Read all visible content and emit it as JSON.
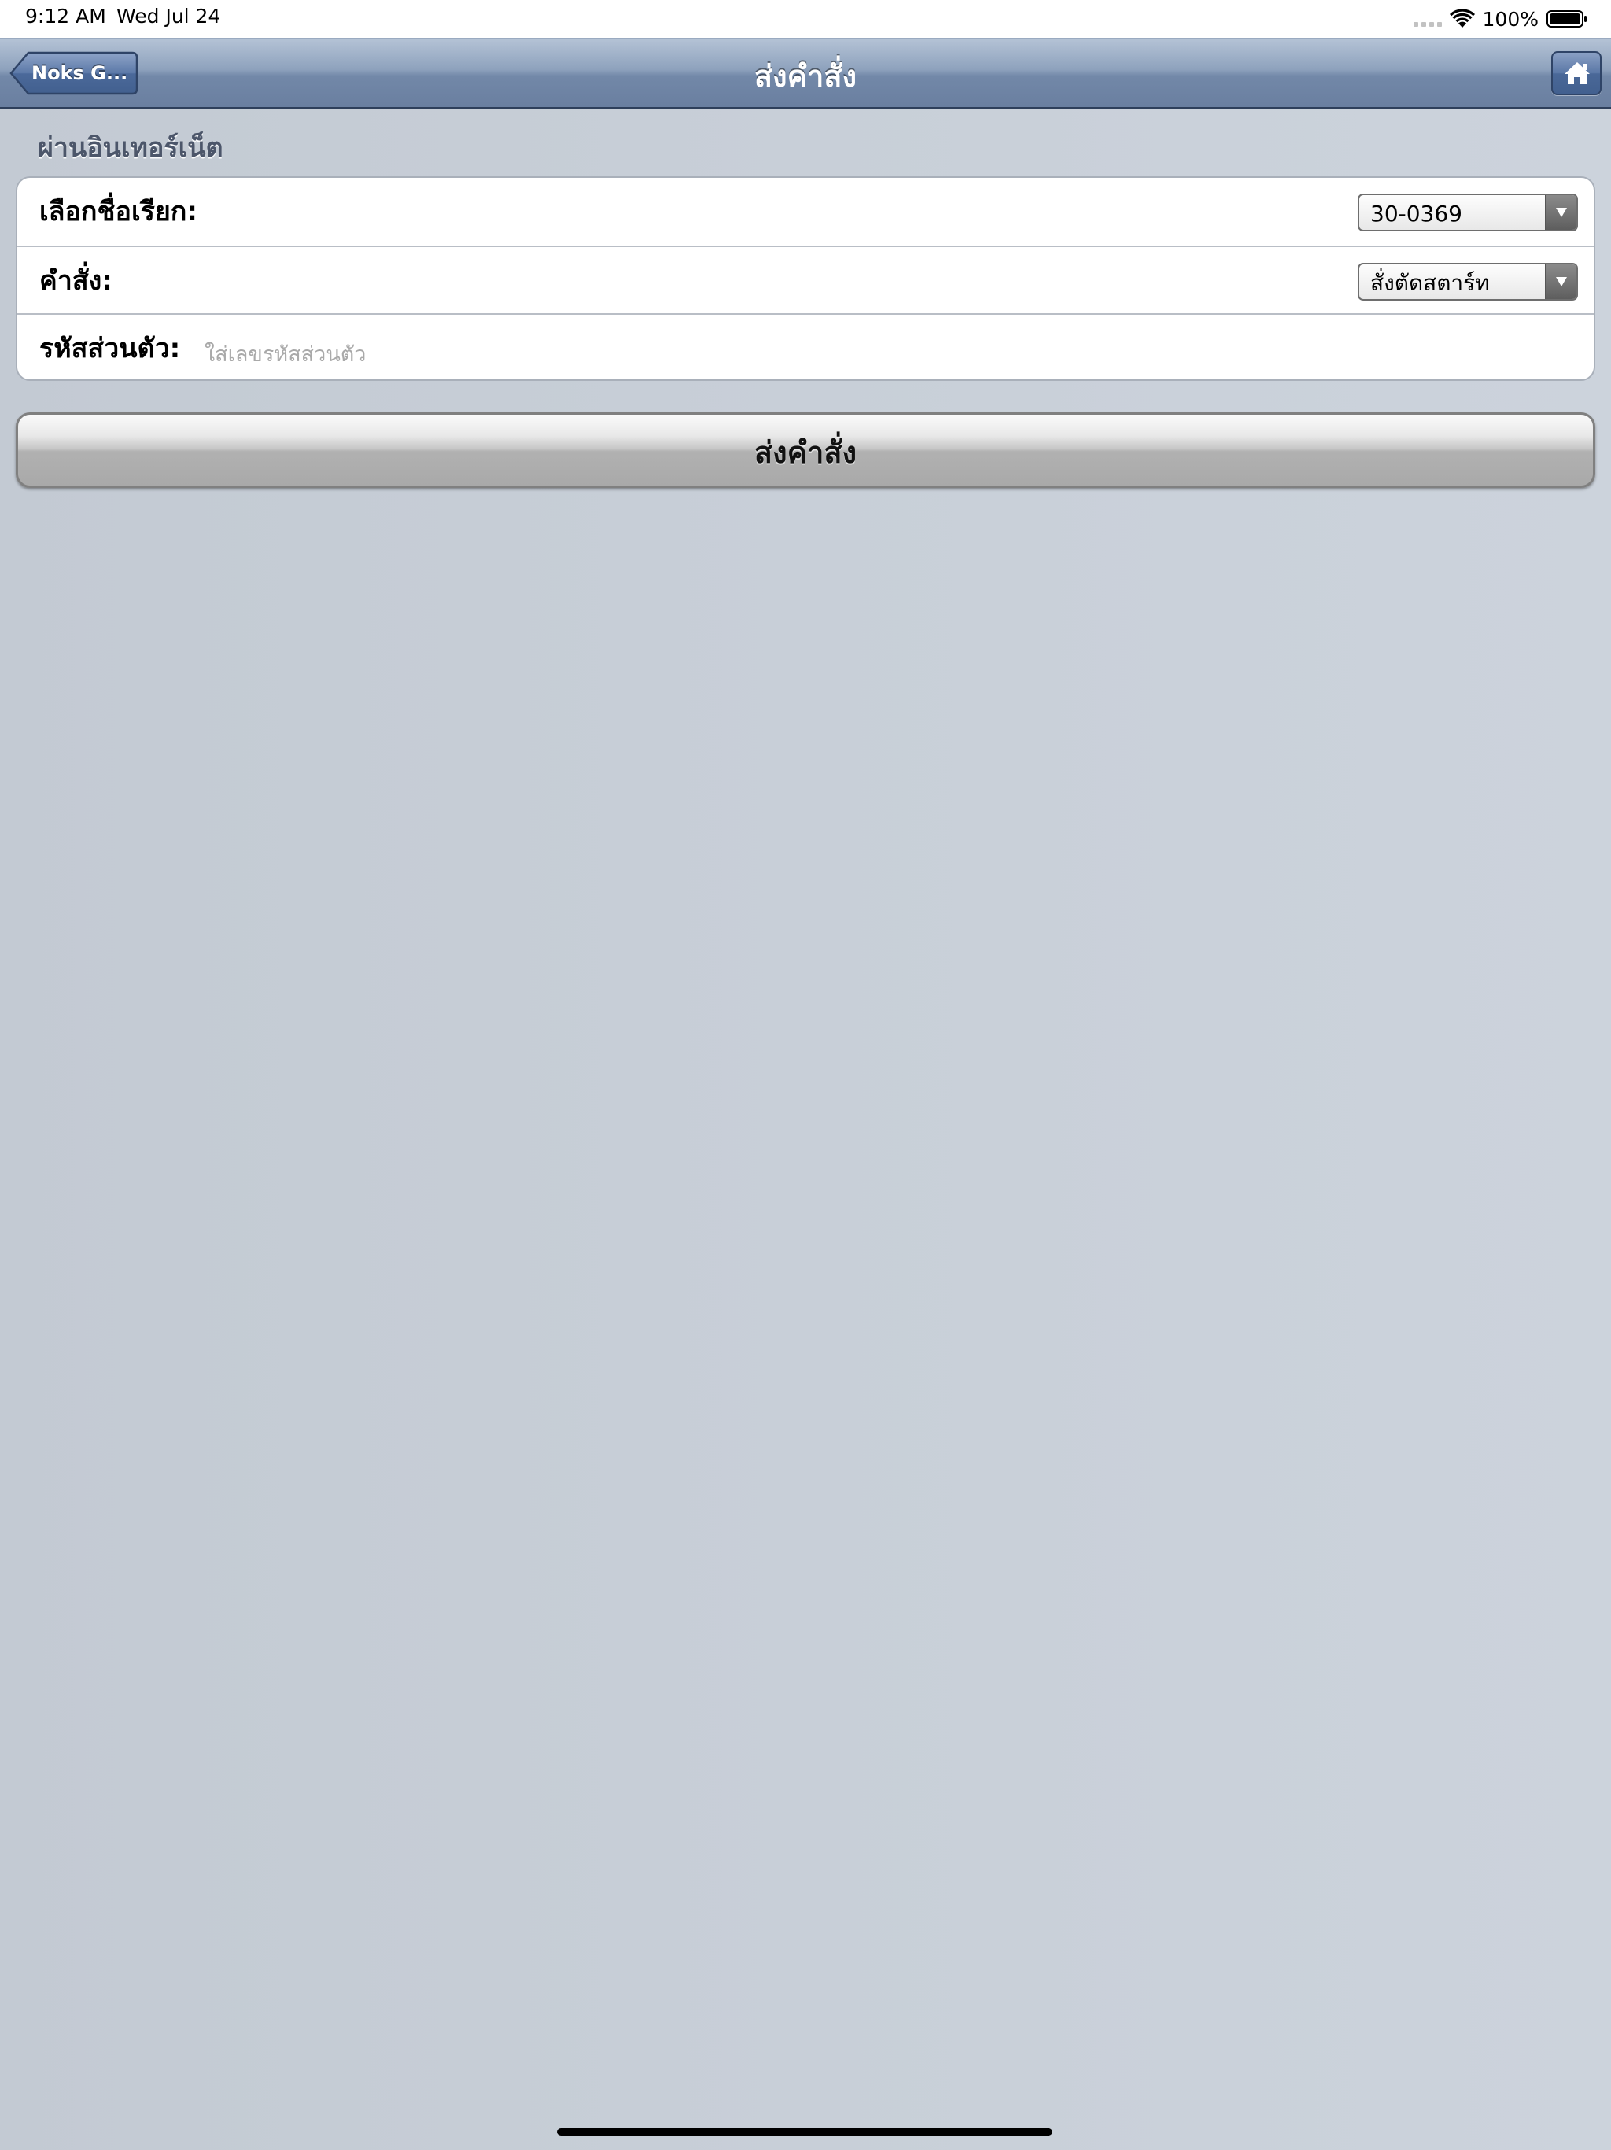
{
  "status_bar": {
    "time": "9:12 AM",
    "date": "Wed Jul 24",
    "battery": "100%",
    "icons": [
      "signal-dots-icon",
      "wifi-icon",
      "battery-icon"
    ]
  },
  "nav": {
    "back_label": "Noks G...",
    "title": "ส่งคำสั่ง",
    "home_icon": "home-icon"
  },
  "section": {
    "header": "ผ่านอินเทอร์เน็ต"
  },
  "form": {
    "rows": [
      {
        "label": "เลือกชื่อเรียก:",
        "value": "30-0369"
      },
      {
        "label": "คำสั่ง:",
        "value": "สั่งตัดสตาร์ท"
      },
      {
        "label": "รหัสส่วนตัว:",
        "placeholder": "ใส่เลขรหัสส่วนตัว",
        "value": ""
      }
    ]
  },
  "send_button": {
    "label": "ส่งคำสั่ง"
  },
  "colors": {
    "nav_top": "#b5c3d6",
    "nav_bottom": "#6a7fa0",
    "background": "#c5ccd5",
    "section_header": "#4c566a"
  }
}
